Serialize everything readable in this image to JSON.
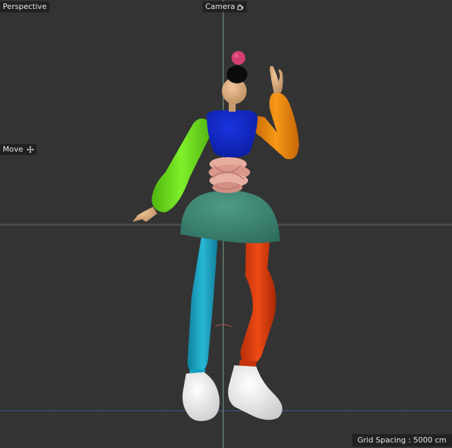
{
  "viewport": {
    "view_name": "Perspective",
    "camera_label": "Camera",
    "camera_icon": "camera-lock-icon",
    "tool_label": "Move",
    "tool_icon": "move-icon",
    "grid_spacing": "Grid Spacing : 5000 cm"
  },
  "colors": {
    "background": "#333333",
    "grid_line": "#3a3a3a",
    "horizon": "#4a4a4a",
    "y_axis": "#7fa88f",
    "x_axis": "#3b5f9a",
    "label_bg": "#1e1e1e",
    "label_text": "#e6e6e6"
  },
  "figure": {
    "hair_bun": "#d33f73",
    "hair": "#0b0b0b",
    "skin": "#d9ab7f",
    "torso": "#1025c4",
    "left_arm": "#6fe31c",
    "right_arm": "#f08a10",
    "waist": "#e2a59a",
    "skirt": "#3f8775",
    "left_leg": "#1aa4c4",
    "right_leg": "#e03d0c",
    "shoes": "#f2f2f2"
  }
}
